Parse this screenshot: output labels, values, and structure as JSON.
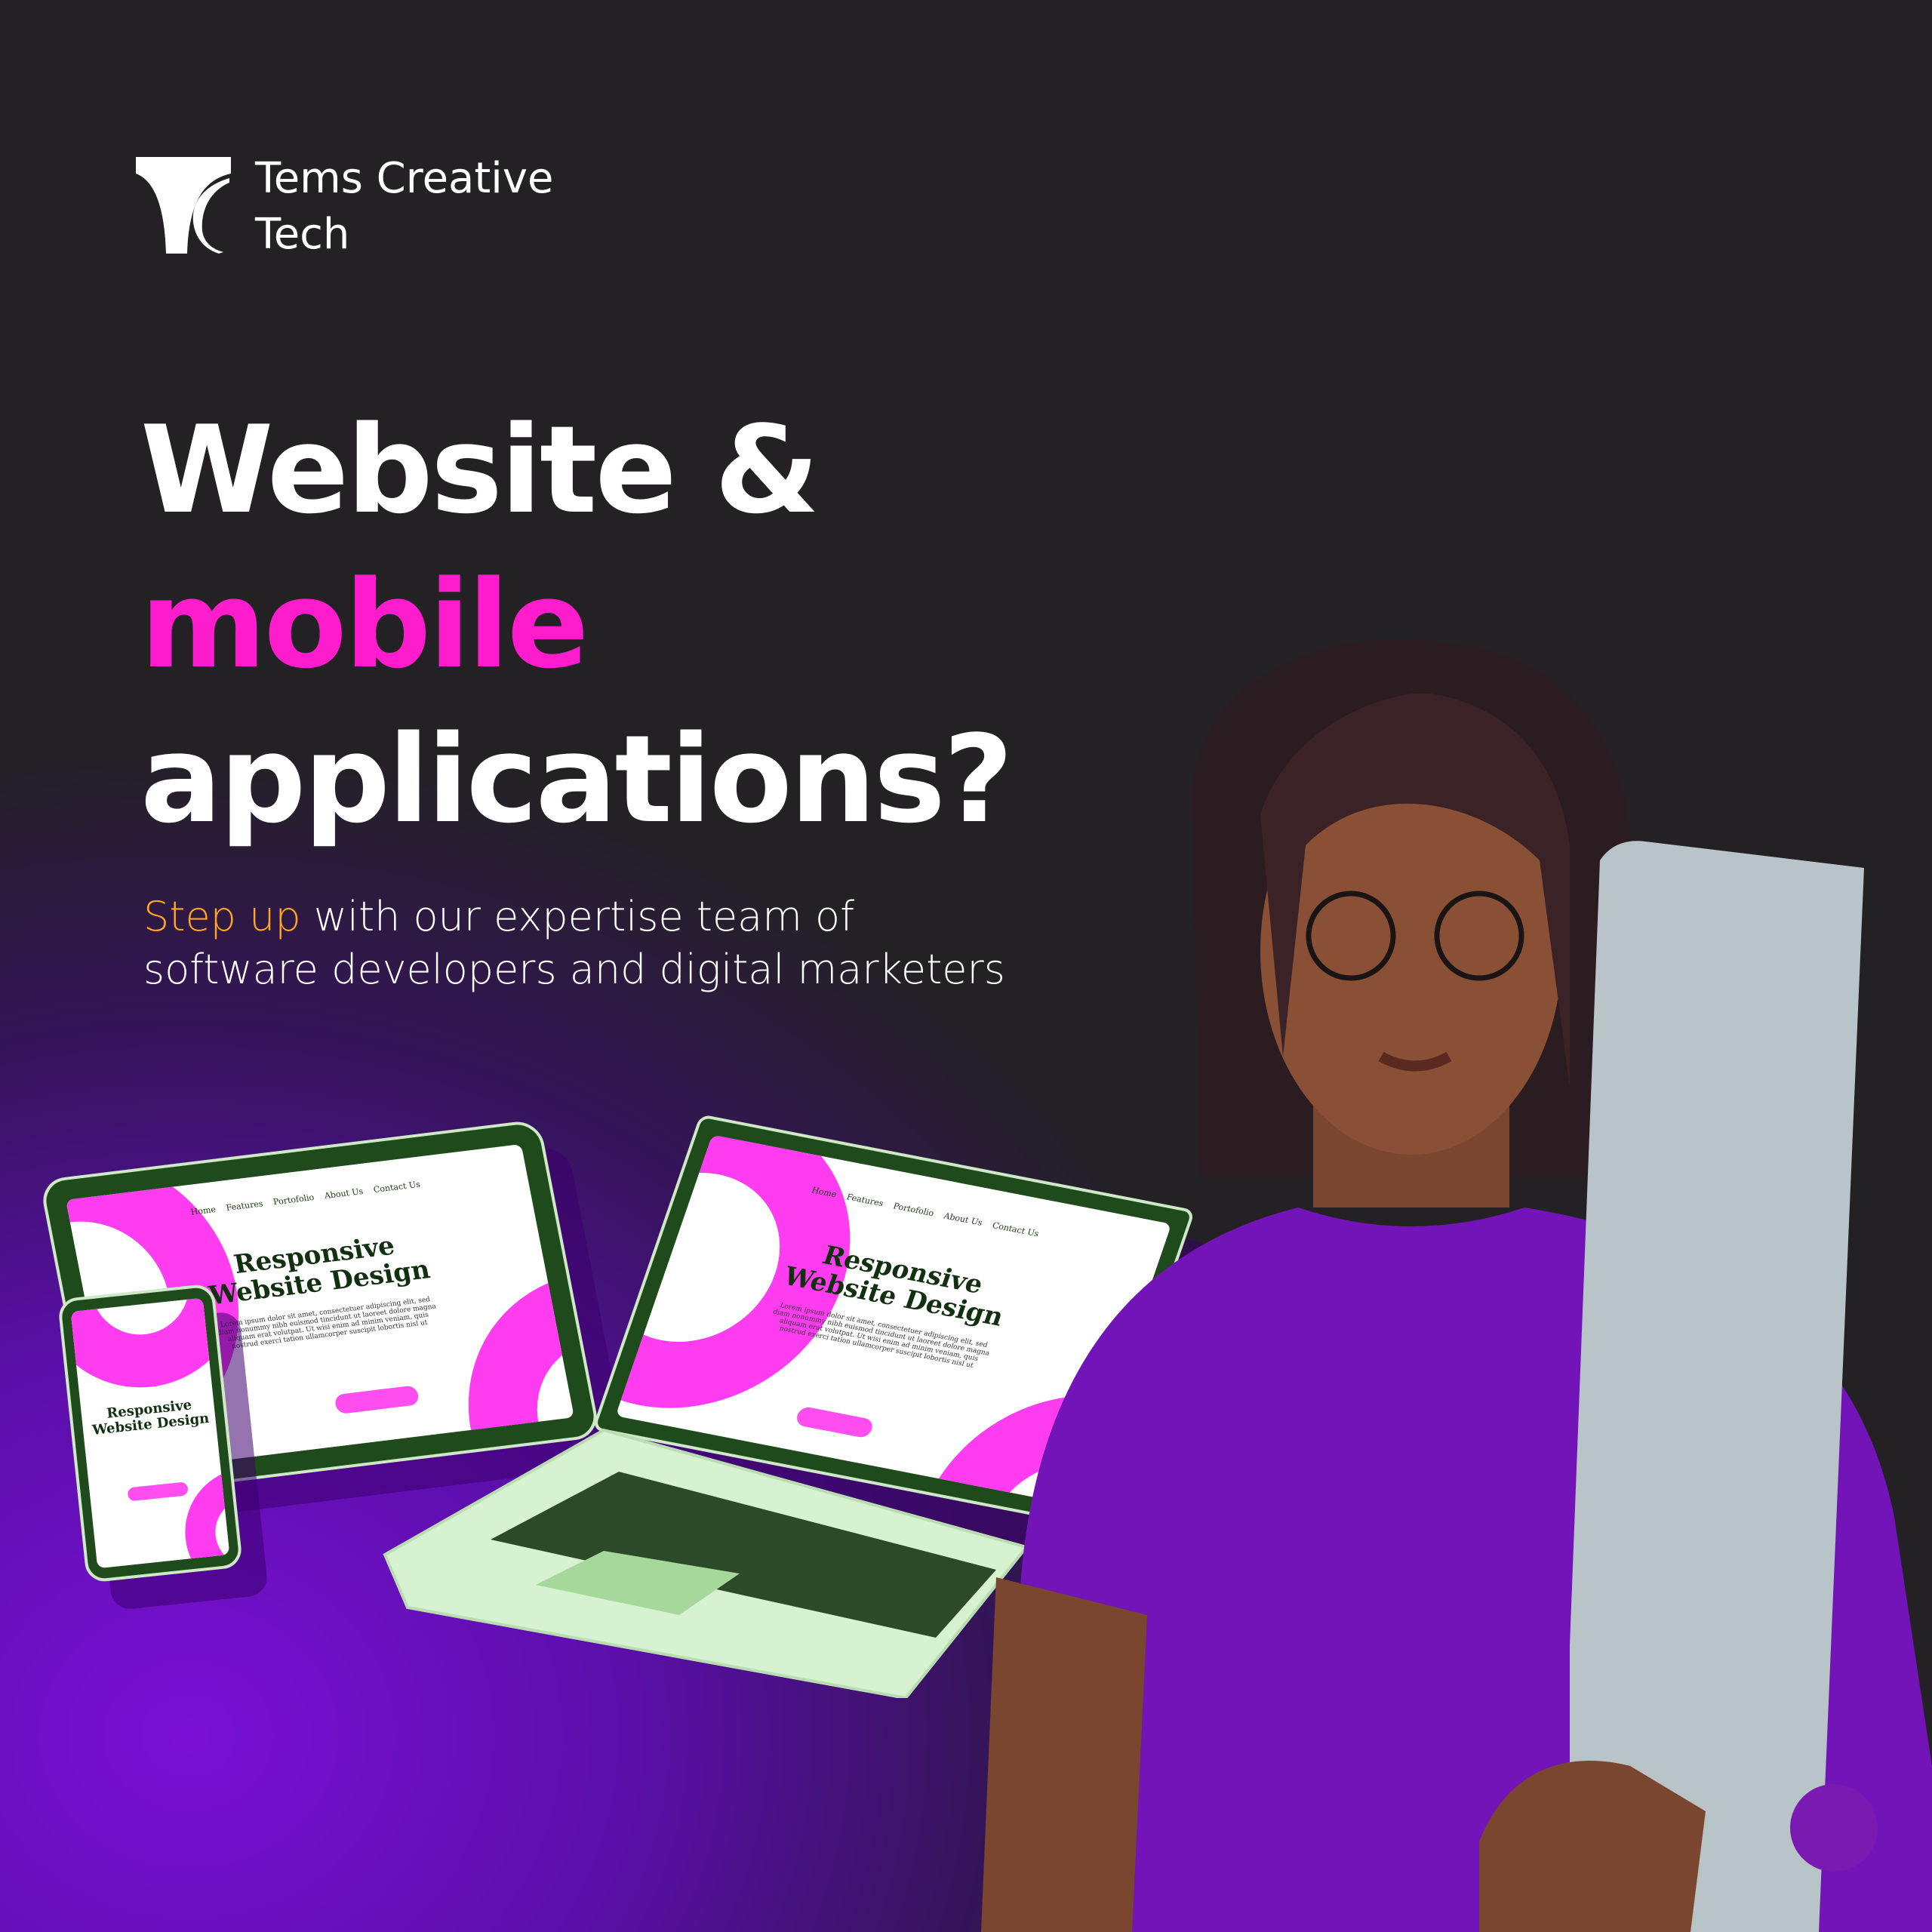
{
  "brand": {
    "line1": "Tems Creative",
    "line2": "Tech"
  },
  "headline": {
    "line1": "Website &",
    "line2": "mobile",
    "line3": "applications?"
  },
  "subtitle": {
    "accent": "Step up",
    "rest_line1": " with our expertise team of",
    "line2": "software developers and digital marketers"
  },
  "mockup": {
    "title_line1": "Responsive",
    "title_line2": "Website Design",
    "nav": [
      "Home",
      "Features",
      "Portofolio",
      "About Us",
      "Contact Us"
    ],
    "lorem": "Lorem ipsum dolor sit amet, consectetuer adipiscing elit, sed diam nonummy nibh euismod tincidunt ut laoreet dolore magna aliquam erat volutpat. Ut wisi enim ad minim veniam, quis nostrud exerci tation ullamcorper suscipit lobortis nisl ut"
  },
  "colors": {
    "accent_pink": "#ff1ccd",
    "accent_orange": "#ffa51f",
    "purple": "#6a10c0",
    "device_green": "#1f4a1b"
  }
}
